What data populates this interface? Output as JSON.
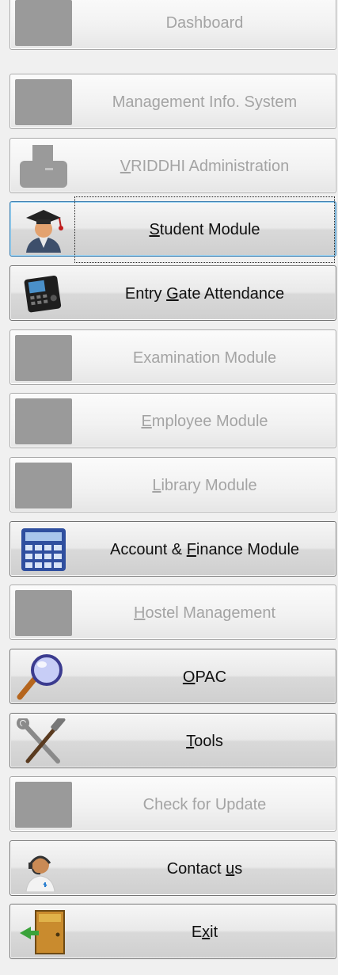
{
  "menu": {
    "items": [
      {
        "key": "dashboard",
        "label": "Dashboard",
        "mnemonic": "",
        "enabled": false,
        "icon": "placeholder-icon"
      },
      {
        "key": "mis",
        "label": "Management Info. System",
        "mnemonic": "",
        "enabled": false,
        "icon": "placeholder-icon"
      },
      {
        "key": "vriddhi-admin",
        "label": "VRIDDHI Administration",
        "mnemonic": "V",
        "enabled": false,
        "icon": "admin-icon"
      },
      {
        "key": "student-module",
        "label": "Student Module",
        "mnemonic": "S",
        "enabled": true,
        "selected": true,
        "icon": "student-graduate-icon"
      },
      {
        "key": "entry-gate-attendance",
        "label": "Entry Gate Attendance",
        "mnemonic": "G",
        "enabled": true,
        "icon": "attendance-device-icon"
      },
      {
        "key": "examination-module",
        "label": "Examination Module",
        "mnemonic": "",
        "enabled": false,
        "icon": "placeholder-icon"
      },
      {
        "key": "employee-module",
        "label": "Employee Module",
        "mnemonic": "E",
        "enabled": false,
        "icon": "placeholder-icon"
      },
      {
        "key": "library-module",
        "label": "Library Module",
        "mnemonic": "L",
        "enabled": false,
        "icon": "placeholder-icon"
      },
      {
        "key": "account-finance-module",
        "label": "Account & Finance Module",
        "mnemonic": "F",
        "enabled": true,
        "icon": "calculator-icon"
      },
      {
        "key": "hostel-management",
        "label": "Hostel Management",
        "mnemonic": "H",
        "enabled": false,
        "icon": "placeholder-icon"
      },
      {
        "key": "opac",
        "label": "OPAC",
        "mnemonic": "O",
        "enabled": true,
        "icon": "magnifier-icon"
      },
      {
        "key": "tools",
        "label": "Tools",
        "mnemonic": "T",
        "enabled": true,
        "icon": "tools-icon"
      },
      {
        "key": "check-for-update",
        "label": "Check for Update",
        "mnemonic": "",
        "enabled": false,
        "icon": "placeholder-icon"
      },
      {
        "key": "contact-us",
        "label": "Contact us",
        "mnemonic": "u",
        "enabled": true,
        "icon": "support-agent-icon"
      },
      {
        "key": "exit",
        "label": "Exit",
        "mnemonic": "x",
        "enabled": true,
        "icon": "exit-door-icon"
      }
    ]
  }
}
